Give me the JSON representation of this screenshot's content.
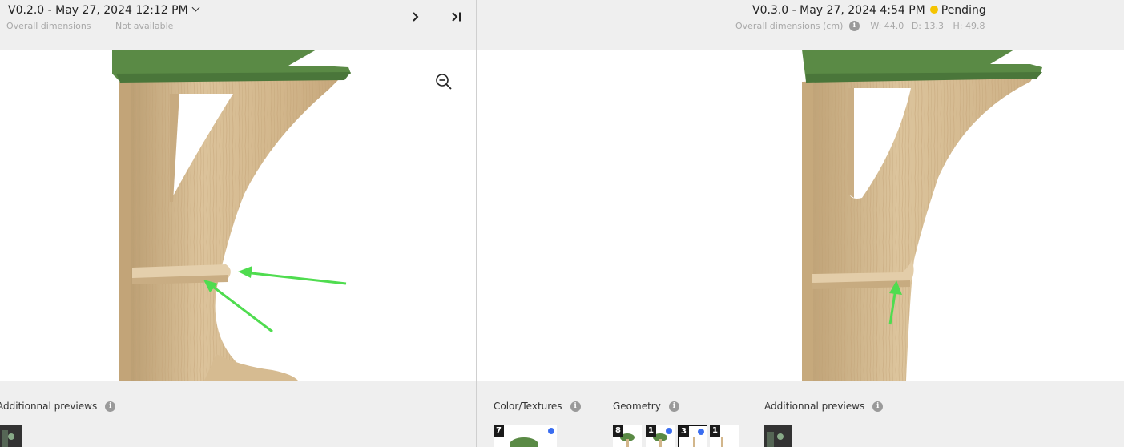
{
  "left": {
    "version_title": "V0.2.0 - May 27, 2024 12:12 PM",
    "dimensions_label": "Overall dimensions",
    "dimensions_value": "Not available",
    "sections": {
      "additional_previews": "Additionnal previews"
    }
  },
  "right": {
    "version_title": "V0.3.0 - May 27, 2024 4:54 PM",
    "status": "Pending",
    "dimensions_label": "Overall dimensions (cm)",
    "dims": {
      "w": "W: 44.0",
      "d": "D: 13.3",
      "h": "H: 49.8"
    },
    "sections": {
      "color_textures": "Color/Textures",
      "geometry": "Geometry",
      "additional_previews": "Additionnal previews"
    },
    "thumbs": {
      "color": [
        {
          "badge": "7",
          "dot": true
        }
      ],
      "geometry": [
        {
          "badge": "8",
          "dot": false
        },
        {
          "badge": "1",
          "dot": true
        },
        {
          "badge": "3",
          "dot": true,
          "selected": true
        },
        {
          "badge": "1",
          "dot": false
        }
      ]
    }
  },
  "colors": {
    "pending": "#f5c400",
    "selection_dot": "#3a6df0",
    "arrow": "#4fdc4f",
    "shelf_green": "#5a8a45",
    "wood": "#d8bf96"
  },
  "icons": [
    "chevron-right-icon",
    "skip-to-end-icon",
    "zoom-out-icon",
    "info-icon",
    "chevron-down-icon"
  ]
}
